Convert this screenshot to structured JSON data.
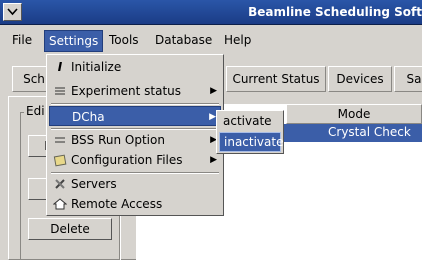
{
  "window": {
    "title": "Beamline Scheduling Soft"
  },
  "menubar": [
    "File",
    "Settings",
    "Tools",
    "Database",
    "Help"
  ],
  "tabs": [
    "Sch",
    "Current Status",
    "Devices",
    "Sa"
  ],
  "left_panel": {
    "group_title": "Edi",
    "button_1": "E",
    "delete": "Delete"
  },
  "table": {
    "column": "Mode",
    "row_mode": "Crystal Check"
  },
  "settings_menu": {
    "items": [
      {
        "label": "Initialize",
        "icon": "initialize-icon",
        "submenu": false
      },
      {
        "label": "Experiment status",
        "icon": "list-icon",
        "submenu": true
      },
      {
        "label": "DCha",
        "icon": "",
        "submenu": true
      },
      {
        "label": "BSS Run Option",
        "icon": "run-icon",
        "submenu": true
      },
      {
        "label": "Configuration Files",
        "icon": "folder-icon",
        "submenu": true
      },
      {
        "label": "Servers",
        "icon": "tools-icon",
        "submenu": false
      },
      {
        "label": "Remote Access",
        "icon": "home-icon",
        "submenu": false
      }
    ]
  },
  "dcha_submenu": {
    "activate": "activate",
    "inactivate": "inactivate"
  },
  "colors": {
    "title_bar": "#1f4591",
    "highlight": "#3b5ea8",
    "background": "#d6d3ce"
  }
}
